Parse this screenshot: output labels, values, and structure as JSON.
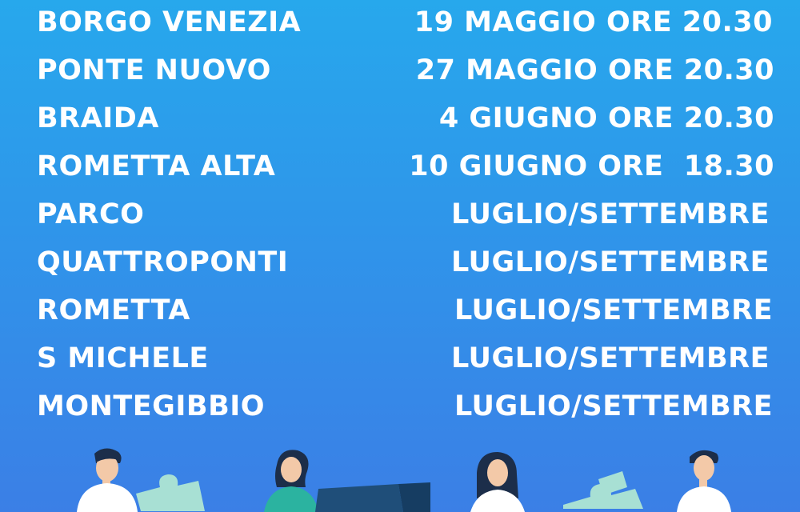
{
  "schedule": {
    "rows": [
      {
        "place": "BORGO VENEZIA",
        "date": "19 MAGGIO ORE 20.30"
      },
      {
        "place": "PONTE NUOVO",
        "date": "27 MAGGIO ORE 20.30"
      },
      {
        "place": "BRAIDA",
        "date": "4 GIUGNO ORE 20.30"
      },
      {
        "place": "ROMETTA ALTA",
        "date": "10 GIUGNO ORE  18.30"
      },
      {
        "place": "PARCO",
        "date": "LUGLIO/SETTEMBRE"
      },
      {
        "place": "QUATTROPONTI",
        "date": "LUGLIO/SETTEMBRE"
      },
      {
        "place": "ROMETTA",
        "date": "LUGLIO/SETTEMBRE"
      },
      {
        "place": "S MICHELE",
        "date": "LUGLIO/SETTEMBRE"
      },
      {
        "place": "MONTEGIBBIO",
        "date": "LUGLIO/SETTEMBRE"
      }
    ]
  },
  "colors": {
    "background_top": "#27a8ec",
    "background_bottom": "#3b7fe6",
    "text": "#ffffff",
    "puzzle_piece_light": "#a8e0d4",
    "puzzle_piece_dark": "#1f4e79",
    "hair": "#1c2e4a",
    "skin": "#f3c9a8",
    "shirt": "#ffffff"
  },
  "illustration": {
    "icon": "people-with-puzzle-pieces-illustration"
  }
}
